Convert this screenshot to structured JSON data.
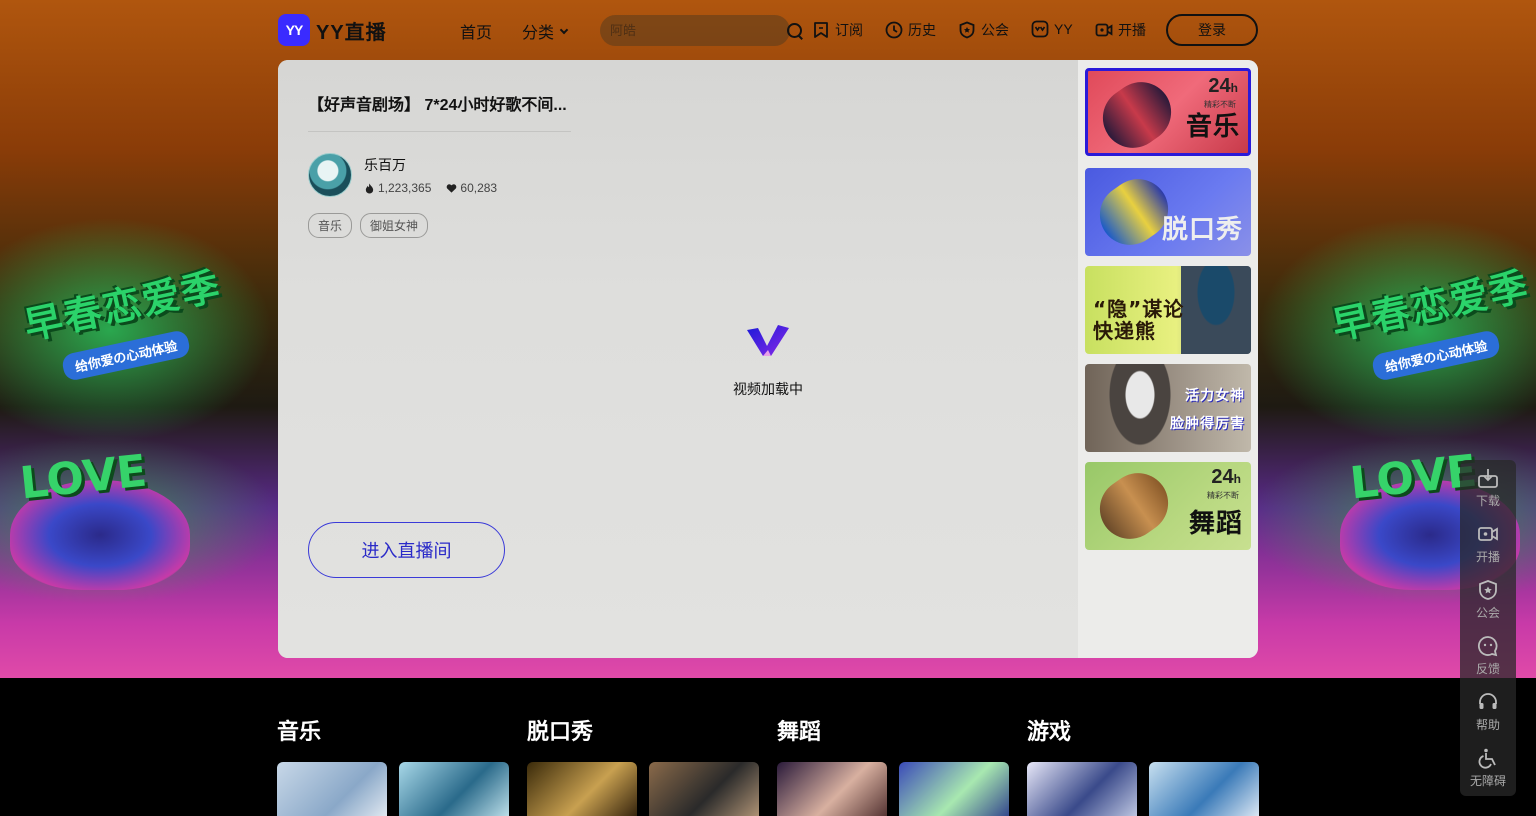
{
  "nav": {
    "logo_badge": "YY",
    "logo_text": "YY直播",
    "home": "首页",
    "category": "分类",
    "search_placeholder": "阿皓",
    "items": [
      {
        "label": "订阅",
        "icon": "bookmark-icon"
      },
      {
        "label": "历史",
        "icon": "clock-icon"
      },
      {
        "label": "公会",
        "icon": "shield-icon"
      },
      {
        "label": "YY",
        "icon": "yy-icon"
      },
      {
        "label": "开播",
        "icon": "camera-icon"
      }
    ],
    "login": "登录"
  },
  "player": {
    "title": "【好声音剧场】 7*24小时好歌不间...",
    "streamer": "乐百万",
    "hot": "1,223,365",
    "likes": "60,283",
    "tags": [
      "音乐",
      "御姐女神"
    ],
    "loading_text": "视频加载中",
    "enter_button": "进入直播间"
  },
  "sidebar_thumbs": [
    {
      "label": "音乐",
      "badge": "24",
      "badge_unit": "h",
      "badge_sub": "精彩不断",
      "active": true
    },
    {
      "label": "脱口秀",
      "active": false
    },
    {
      "label": "“隐”谋论\n快递熊",
      "active": false
    },
    {
      "label": "活力女神\n脸肿得厉害",
      "active": false
    },
    {
      "label": "舞蹈",
      "badge": "24",
      "badge_unit": "h",
      "badge_sub": "精彩不断",
      "active": false
    }
  ],
  "hero_decor": {
    "title": "早春恋爱季",
    "subtitle": "给你爱の心动体验",
    "love": "LOVE"
  },
  "sections": [
    {
      "title": "音乐"
    },
    {
      "title": "脱口秀"
    },
    {
      "title": "舞蹈"
    },
    {
      "title": "游戏"
    }
  ],
  "floatbar": [
    {
      "label": "下载",
      "icon": "download-icon"
    },
    {
      "label": "开播",
      "icon": "camera-icon"
    },
    {
      "label": "公会",
      "icon": "shield-icon"
    },
    {
      "label": "反馈",
      "icon": "feedback-icon"
    },
    {
      "label": "帮助",
      "icon": "headset-icon"
    },
    {
      "label": "无障碍",
      "icon": "accessibility-icon"
    }
  ],
  "colors": {
    "brand": "#3a2bff",
    "accent": "#2a2ac8",
    "hero_green": "#2bd36a",
    "hero_pink": "#e04aa8"
  }
}
